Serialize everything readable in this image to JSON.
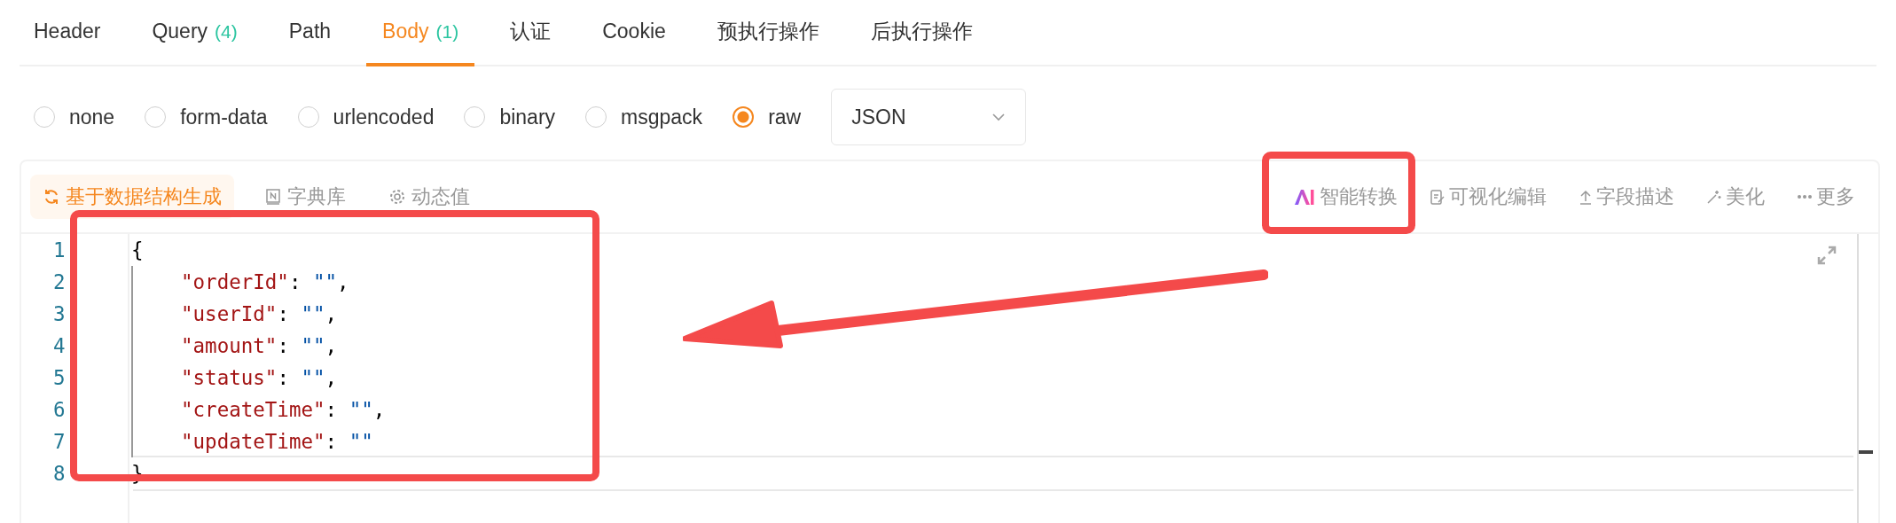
{
  "tabs": [
    {
      "label": "Header",
      "selected": false
    },
    {
      "label": "Query",
      "count": "(4)",
      "selected": false
    },
    {
      "label": "Path",
      "selected": false
    },
    {
      "label": "Body",
      "count": "(1)",
      "selected": true
    },
    {
      "label": "认证",
      "selected": false
    },
    {
      "label": "Cookie",
      "selected": false
    },
    {
      "label": "预执行操作",
      "selected": false
    },
    {
      "label": "后执行操作",
      "selected": false
    }
  ],
  "body_types": [
    {
      "label": "none",
      "selected": false
    },
    {
      "label": "form-data",
      "selected": false
    },
    {
      "label": "urlencoded",
      "selected": false
    },
    {
      "label": "binary",
      "selected": false
    },
    {
      "label": "msgpack",
      "selected": false
    },
    {
      "label": "raw",
      "selected": true
    }
  ],
  "format_select": {
    "value": "JSON"
  },
  "toolbar_left": [
    {
      "label": "基于数据结构生成",
      "active": true
    },
    {
      "label": "字典库",
      "active": false
    },
    {
      "label": "动态值",
      "active": false
    }
  ],
  "toolbar_right": [
    {
      "label": "智能转换"
    },
    {
      "label": "可视化编辑"
    },
    {
      "label": "字段描述"
    },
    {
      "label": "美化"
    },
    {
      "label": "更多"
    }
  ],
  "editor": {
    "lines": [
      {
        "number": "1",
        "indented": false,
        "active": false,
        "tokens": [
          {
            "kind": "punct",
            "text": "{"
          }
        ]
      },
      {
        "number": "2",
        "indented": true,
        "active": false,
        "tokens": [
          {
            "kind": "key",
            "text": "\"orderId\""
          },
          {
            "kind": "punct",
            "text": ": "
          },
          {
            "kind": "string",
            "text": "\"\""
          },
          {
            "kind": "punct",
            "text": ","
          }
        ]
      },
      {
        "number": "3",
        "indented": true,
        "active": false,
        "tokens": [
          {
            "kind": "key",
            "text": "\"userId\""
          },
          {
            "kind": "punct",
            "text": ": "
          },
          {
            "kind": "string",
            "text": "\"\""
          },
          {
            "kind": "punct",
            "text": ","
          }
        ]
      },
      {
        "number": "4",
        "indented": true,
        "active": false,
        "tokens": [
          {
            "kind": "key",
            "text": "\"amount\""
          },
          {
            "kind": "punct",
            "text": ": "
          },
          {
            "kind": "string",
            "text": "\"\""
          },
          {
            "kind": "punct",
            "text": ","
          }
        ]
      },
      {
        "number": "5",
        "indented": true,
        "active": false,
        "tokens": [
          {
            "kind": "key",
            "text": "\"status\""
          },
          {
            "kind": "punct",
            "text": ": "
          },
          {
            "kind": "string",
            "text": "\"\""
          },
          {
            "kind": "punct",
            "text": ","
          }
        ]
      },
      {
        "number": "6",
        "indented": true,
        "active": false,
        "tokens": [
          {
            "kind": "key",
            "text": "\"createTime\""
          },
          {
            "kind": "punct",
            "text": ": "
          },
          {
            "kind": "string",
            "text": "\"\""
          },
          {
            "kind": "punct",
            "text": ","
          }
        ]
      },
      {
        "number": "7",
        "indented": true,
        "active": false,
        "tokens": [
          {
            "kind": "key",
            "text": "\"updateTime\""
          },
          {
            "kind": "punct",
            "text": ": "
          },
          {
            "kind": "string",
            "text": "\"\""
          }
        ]
      },
      {
        "number": "8",
        "indented": false,
        "active": true,
        "tokens": [
          {
            "kind": "punct",
            "text": "}"
          }
        ]
      }
    ]
  }
}
